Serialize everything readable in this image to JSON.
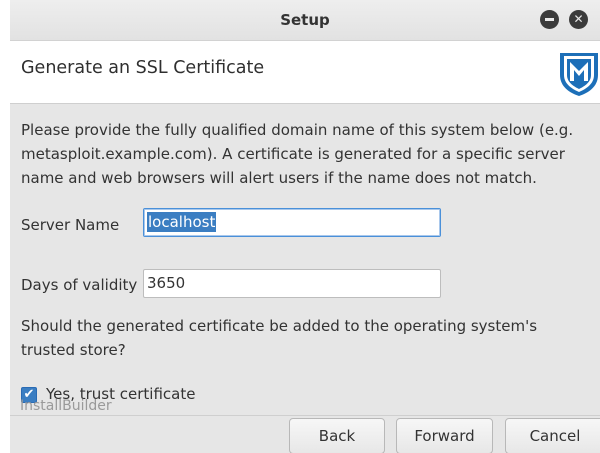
{
  "window": {
    "title": "Setup",
    "minimize_icon": "minimize-icon",
    "close_icon": "close-icon"
  },
  "header": {
    "title": "Generate an SSL Certificate",
    "logo_icon": "metasploit-shield-logo",
    "logo_color": "#1d6fb8"
  },
  "content": {
    "description": "Please provide the fully qualified domain name of this system below (e.g. metasploit.example.com). A certificate is generated for a specific server name and web browsers will alert users if the name does not match.",
    "server_name": {
      "label": "Server Name",
      "value": "localhost"
    },
    "days_validity": {
      "label": "Days of validity",
      "value": "3650"
    },
    "trust_question": "Should the generated certificate be added to the operating system's trusted store?",
    "trust_checkbox": {
      "label": "Yes, trust certificate",
      "checked": true
    }
  },
  "footer": {
    "watermark": "InstallBuilder",
    "back_label": "Back",
    "forward_label": "Forward",
    "cancel_label": "Cancel"
  },
  "colors": {
    "selection": "#3b7ec2",
    "focus_border": "#4a90d9"
  }
}
